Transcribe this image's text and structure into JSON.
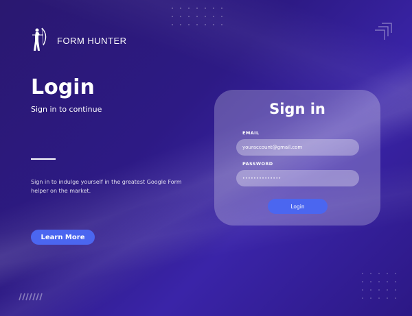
{
  "brand": {
    "name": "FORM HUNTER",
    "logo_icon": "archer-icon"
  },
  "left": {
    "title": "Login",
    "subtitle": "Sign in to continue",
    "description": "Sign in to indulge yourself in the greatest Google Form helper on the market.",
    "learn_more_label": "Learn More"
  },
  "card": {
    "title": "Sign in",
    "email": {
      "label": "EMAIL",
      "value": "youraccount@gmail.com"
    },
    "password": {
      "label": "PASSWORD",
      "value": "••••••••••••••"
    },
    "login_label": "Login"
  },
  "colors": {
    "accent": "#4b66f0",
    "background": "#2d1a85",
    "card": "rgba(255,255,255,0.24)"
  }
}
